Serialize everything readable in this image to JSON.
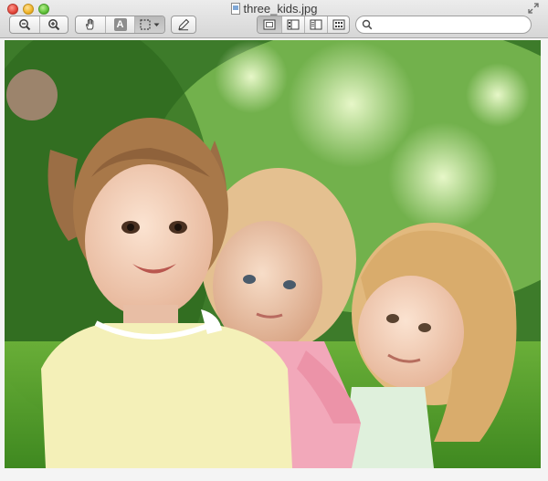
{
  "window": {
    "title": "three_kids.jpg",
    "traffic_lights": {
      "close": "close-button",
      "minimize": "minimize-button",
      "zoom": "zoom-button"
    }
  },
  "toolbar": {
    "zoom_group": [
      {
        "icon": "zoom-out-icon"
      },
      {
        "icon": "zoom-in-icon"
      }
    ],
    "tools_group": [
      {
        "icon": "hand-icon"
      },
      {
        "icon": "text-select-icon",
        "glyph": "A"
      },
      {
        "icon": "rect-select-icon",
        "active": true,
        "has_menu": true
      }
    ],
    "annotate": {
      "icon": "pencil-icon"
    },
    "view_group": [
      {
        "icon": "content-only-icon",
        "active": true
      },
      {
        "icon": "thumbnails-icon"
      },
      {
        "icon": "table-of-contents-icon"
      },
      {
        "icon": "contact-sheet-icon"
      }
    ],
    "search": {
      "placeholder": "",
      "value": ""
    }
  },
  "colors": {
    "titlebar_top": "#ececec",
    "titlebar_bottom": "#d6d6d6",
    "photo_green": "#3e7f2a",
    "shirt_yellow": "#f4f0b8",
    "shirt_pink": "#f2a8ba",
    "hair_blonde": "#e8c48a"
  },
  "photo": {
    "description_icon": "photo-image"
  }
}
